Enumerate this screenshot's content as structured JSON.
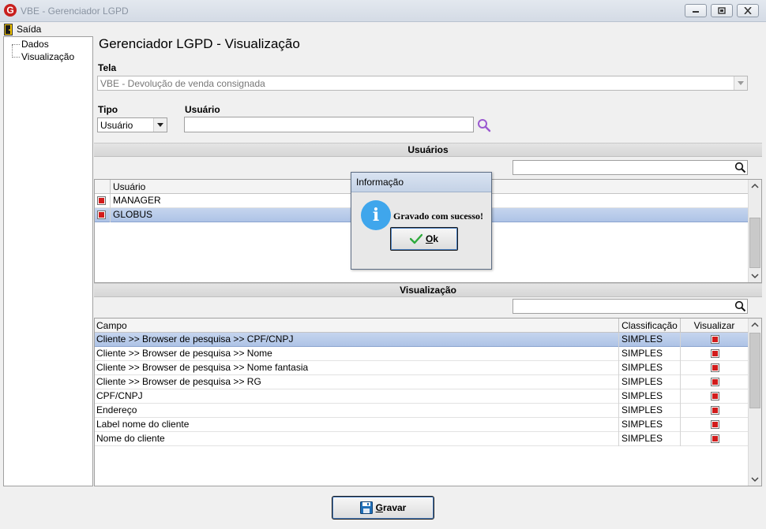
{
  "window": {
    "title": "VBE - Gerenciador LGPD",
    "app_icon_letter": "G"
  },
  "menu": {
    "exit_label": "Saída"
  },
  "tree": {
    "items": [
      "Dados",
      "Visualização"
    ]
  },
  "page_title": "Gerenciador LGPD - Visualização",
  "tela": {
    "label": "Tela",
    "value": "VBE - Devolução de venda consignada"
  },
  "tipo": {
    "label": "Tipo",
    "value": "Usuário"
  },
  "usuario_field": {
    "label": "Usuário",
    "value": ""
  },
  "users_section": {
    "title": "Usuários",
    "column": "Usuário",
    "rows": [
      {
        "name": "MANAGER",
        "checked": true,
        "selected": false
      },
      {
        "name": "GLOBUS",
        "checked": true,
        "selected": true
      }
    ]
  },
  "view_section": {
    "title": "Visualização",
    "columns": [
      "Campo",
      "Classificação",
      "Visualizar"
    ],
    "rows": [
      {
        "campo": "Cliente >> Browser de pesquisa >> CPF/CNPJ",
        "classificacao": "SIMPLES",
        "visualizar": true,
        "selected": true
      },
      {
        "campo": "Cliente >> Browser de pesquisa >> Nome",
        "classificacao": "SIMPLES",
        "visualizar": true,
        "selected": false
      },
      {
        "campo": "Cliente >> Browser de pesquisa >> Nome fantasia",
        "classificacao": "SIMPLES",
        "visualizar": true,
        "selected": false
      },
      {
        "campo": "Cliente >> Browser de pesquisa >> RG",
        "classificacao": "SIMPLES",
        "visualizar": true,
        "selected": false
      },
      {
        "campo": "CPF/CNPJ",
        "classificacao": "SIMPLES",
        "visualizar": true,
        "selected": false
      },
      {
        "campo": "Endereço",
        "classificacao": "SIMPLES",
        "visualizar": true,
        "selected": false
      },
      {
        "campo": "Label nome do cliente",
        "classificacao": "SIMPLES",
        "visualizar": true,
        "selected": false
      },
      {
        "campo": "Nome do cliente",
        "classificacao": "SIMPLES",
        "visualizar": true,
        "selected": false
      }
    ]
  },
  "save_button": "Gravar",
  "dialog": {
    "title": "Informação",
    "icon_letter": "i",
    "message": "Gravado com sucesso!",
    "ok_label": "Ok"
  },
  "colors": {
    "selection": "#b4c8e8",
    "check_red": "#d21c1c",
    "info_blue": "#3fa6ec",
    "search_purple": "#9b59d0"
  }
}
